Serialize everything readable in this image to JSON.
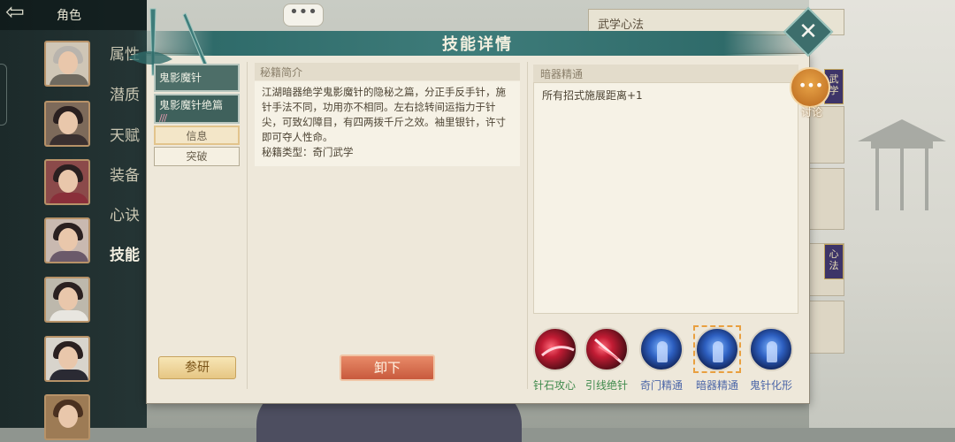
{
  "nav": {
    "title": "角色",
    "menu": [
      "属性",
      "潜质",
      "天赋",
      "装备",
      "心诀",
      "技能"
    ],
    "active_menu": "技能"
  },
  "chat_bubble": "•••",
  "right_panel": {
    "header": "武学心法",
    "tags": [
      "武学",
      "心法"
    ]
  },
  "dialog": {
    "title": "技能详情",
    "close_glyph": "✕",
    "tabs": [
      "鬼影魔针",
      "鬼影魔针绝篇"
    ],
    "tab_pips": "///",
    "subtabs": [
      "信息",
      "突破"
    ],
    "intro": {
      "header": "秘籍简介",
      "text": "江湖暗器绝学鬼影魔针的隐秘之篇，分正手反手针，施针手法不同，功用亦不相同。左右捻转间运指力于针尖，可致幻障目，有四两拨千斤之效。袖里银针，许寸即可夺人性命。",
      "type_label": "秘籍类型：奇门武学"
    },
    "mastery": {
      "header": "暗器精通",
      "text": "所有招式施展距离+1"
    },
    "skills": [
      {
        "label": "针石攻心",
        "style": "red"
      },
      {
        "label": "引线绝针",
        "style": "red"
      },
      {
        "label": "奇门精通",
        "style": "blue"
      },
      {
        "label": "暗器精通",
        "style": "blue",
        "selected": true
      },
      {
        "label": "鬼针化形",
        "style": "blue"
      }
    ],
    "research_button": "参研",
    "unload_button": "卸下"
  },
  "discuss": {
    "icon": "•••",
    "label": "讨论"
  }
}
